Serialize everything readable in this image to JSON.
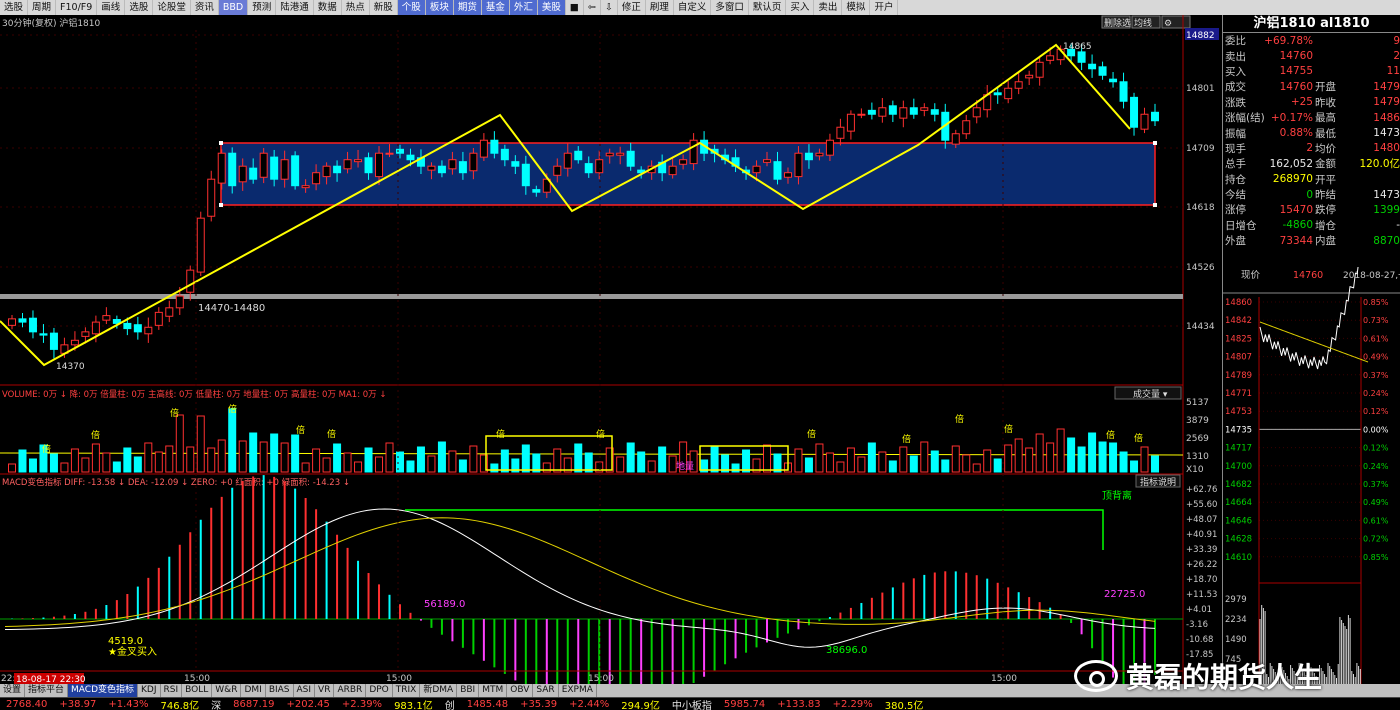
{
  "toolbar": {
    "items": [
      "选股",
      "周期",
      "F10/F9",
      "画线",
      "选股",
      "论股堂",
      "资讯",
      "BBD",
      "预测",
      "陆港通",
      "数据",
      "热点",
      "新股",
      "个股",
      "板块",
      "期货",
      "基金",
      "外汇",
      "美股",
      "■",
      "⇦",
      "⇩",
      "修正",
      "刷理",
      "自定义",
      "多窗口",
      "默认页",
      "买入",
      "卖出",
      "模拟",
      "开户"
    ]
  },
  "chart": {
    "header_label": "30分钟(复权) 沪铝1810",
    "toggle_buttons": [
      "删除选",
      "均线",
      "⚙"
    ],
    "price_ticks": [
      "14882",
      "14801",
      "14709",
      "14618",
      "14526",
      "14434"
    ],
    "annotations": {
      "high_label": "14865",
      "low_label": "14370",
      "support_label": "14470-14480"
    },
    "volume_label": "VOLUME: 0万 ↓ 降: 0万 倍量柱: 0万 主高线: 0万 低量柱: 0万 地量柱: 0万 高量柱: 0万 MA1: 0万 ↓",
    "volume_dropdown": "成交量",
    "volume_ticks": [
      "5137",
      "3879",
      "2569",
      "1310",
      "X10"
    ],
    "volume_marker": "倍",
    "volume_ground": "地量",
    "macd_label": "MACD变色指标 DIFF: -13.58 ↓ DEA: -12.09 ↓ ZERO: +0 红面积: +0 绿面积: -14.23 ↓",
    "macd_help": "指标说明",
    "macd_ticks": [
      "+62.76",
      "+55.60",
      "+48.07",
      "+40.91",
      "+33.39",
      "+26.22",
      "+18.70",
      "+11.53",
      "+4.01",
      "-3.16",
      "-10.68",
      "-17.85"
    ],
    "macd_annotations": {
      "divergence": "顶背离",
      "golden_cross": "★金叉买入",
      "v1": "4519.0",
      "v2": "56189.0",
      "v3": "38696.0",
      "v4": "22725.0"
    },
    "time_ticks": [
      "15:00",
      "15:00",
      "15:00",
      "15:00"
    ],
    "left_time": "22:00",
    "cursor_time": "18-08-17 22:30"
  },
  "quote": {
    "title": "沪铝1810 al1810",
    "rows": [
      {
        "l": "委比",
        "v": "+69.78%",
        "vc": "red",
        "l2": "",
        "v2": "9",
        "v2c": "red"
      },
      {
        "l": "卖出",
        "v": "14760",
        "vc": "red",
        "l2": "",
        "v2": "2",
        "v2c": "red"
      },
      {
        "l": "买入",
        "v": "14755",
        "vc": "red",
        "l2": "",
        "v2": "11",
        "v2c": "red"
      },
      {
        "l": "成交",
        "v": "14760",
        "vc": "red",
        "l2": "开盘",
        "v2": "1479",
        "v2c": "red"
      },
      {
        "l": "涨跌",
        "v": "+25",
        "vc": "red",
        "l2": "昨收",
        "v2": "1479",
        "v2c": "red"
      },
      {
        "l": "涨幅(结)",
        "v": "+0.17%",
        "vc": "red",
        "l2": "最高",
        "v2": "1486",
        "v2c": "red"
      },
      {
        "l": "振幅",
        "v": "0.88%",
        "vc": "red",
        "l2": "最低",
        "v2": "1473",
        "v2c": "white"
      },
      {
        "l": "现手",
        "v": "2",
        "vc": "red",
        "l2": "均价",
        "v2": "1480",
        "v2c": "red"
      },
      {
        "l": "总手",
        "v": "162,052",
        "vc": "white",
        "l2": "金额",
        "v2": "120.0亿",
        "v2c": "yellow"
      },
      {
        "l": "持仓",
        "v": "268970",
        "vc": "yellow",
        "l2": "开平",
        "v2": "",
        "v2c": "white"
      },
      {
        "l": "今结",
        "v": "0",
        "vc": "green",
        "l2": "昨结",
        "v2": "1473",
        "v2c": "white"
      },
      {
        "l": "涨停",
        "v": "15470",
        "vc": "red",
        "l2": "跌停",
        "v2": "1399",
        "v2c": "green"
      },
      {
        "l": "日增仓",
        "v": "-4860",
        "vc": "green",
        "l2": "增仓",
        "v2": "-",
        "v2c": "white"
      },
      {
        "l": "外盘",
        "v": "73344",
        "vc": "red",
        "l2": "内盘",
        "v2": "8870",
        "v2c": "green"
      }
    ]
  },
  "intraday": {
    "label": "现价",
    "price": "14760",
    "date": "2018-08-27,一",
    "price_ticks": [
      "14860",
      "14842",
      "14825",
      "14807",
      "14789",
      "14771",
      "14753",
      "14735",
      "14717",
      "14700",
      "14682",
      "14664",
      "14646",
      "14628",
      "14610"
    ],
    "pct_ticks": [
      "0.85%",
      "0.73%",
      "0.61%",
      "0.49%",
      "0.37%",
      "0.24%",
      "0.12%",
      "0.00%",
      "0.12%",
      "0.24%",
      "0.37%",
      "0.49%",
      "0.61%",
      "0.72%",
      "0.85%"
    ],
    "vol_ticks": [
      "2979",
      "2234",
      "1490",
      "745"
    ]
  },
  "tabs": [
    "设置",
    "指标平台",
    "MACD变色指标",
    "KDJ",
    "RSI",
    "BOLL",
    "W&R",
    "DMI",
    "BIAS",
    "ASI",
    "VR",
    "ARBR",
    "DPO",
    "TRIX",
    "新DMA",
    "BBI",
    "MTM",
    "OBV",
    "SAR",
    "EXPMA"
  ],
  "indexbar": [
    {
      "t": "2768.40",
      "c": "red"
    },
    {
      "t": "+38.97",
      "c": "red"
    },
    {
      "t": "+1.43%",
      "c": "red"
    },
    {
      "t": "746.8亿",
      "c": "yellow"
    },
    {
      "t": "深",
      "c": "white"
    },
    {
      "t": "8687.19",
      "c": "red"
    },
    {
      "t": "+202.45",
      "c": "red"
    },
    {
      "t": "+2.39%",
      "c": "red"
    },
    {
      "t": "983.1亿",
      "c": "yellow"
    },
    {
      "t": "创",
      "c": "white"
    },
    {
      "t": "1485.48",
      "c": "red"
    },
    {
      "t": "+35.39",
      "c": "red"
    },
    {
      "t": "+2.44%",
      "c": "red"
    },
    {
      "t": "294.9亿",
      "c": "yellow"
    },
    {
      "t": "中小板指",
      "c": "white"
    },
    {
      "t": "5985.74",
      "c": "red"
    },
    {
      "t": "+133.83",
      "c": "red"
    },
    {
      "t": "+2.29%",
      "c": "red"
    },
    {
      "t": "380.5亿",
      "c": "yellow"
    }
  ],
  "watermark": "黄磊的期货人生",
  "colors": {
    "up": "#ff3030",
    "down": "#00ffff",
    "zigzag": "#ffff00",
    "box_fill": "#0a2a6e",
    "box_edge": "#ff2020",
    "dif": "#ffffff",
    "dea": "#e0d000"
  }
}
